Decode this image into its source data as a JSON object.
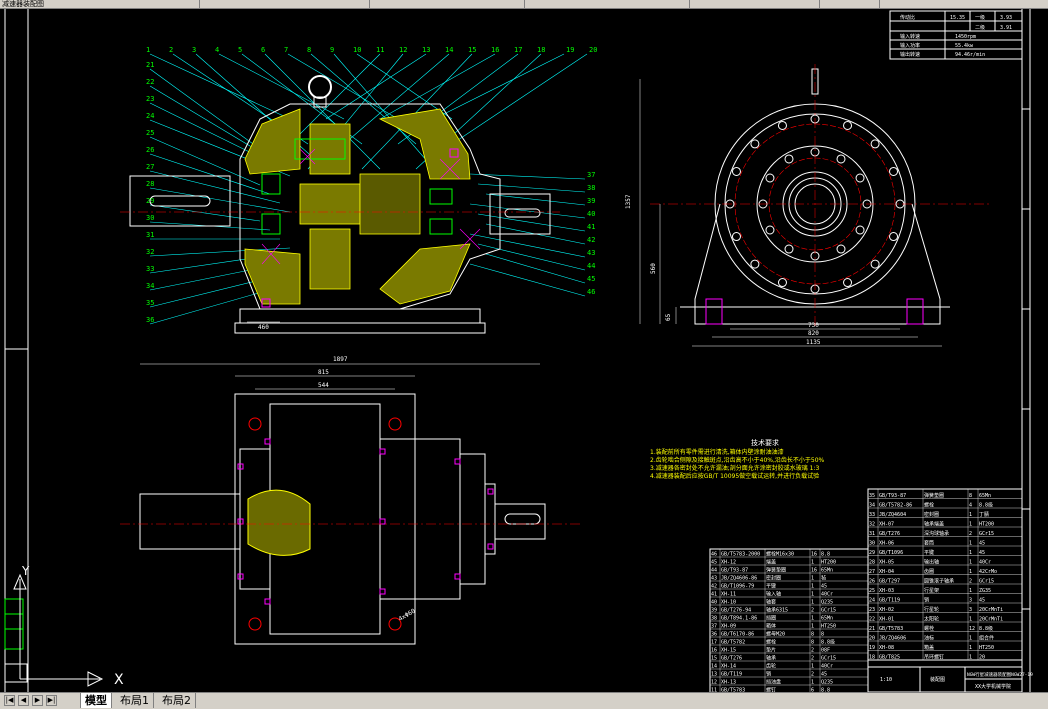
{
  "app": {
    "tabs_top": [
      "减速器装配图",
      "",
      "",
      "",
      "",
      "",
      "",
      ""
    ]
  },
  "layout_tabs": [
    {
      "label": "模型",
      "active": true
    },
    {
      "label": "布局1",
      "active": false
    },
    {
      "label": "布局2",
      "active": false
    }
  ],
  "ucs": {
    "x_label": "X",
    "y_label": "Y"
  },
  "params_table": {
    "rows": [
      {
        "k": "传动比",
        "v1": "15.35",
        "v2": "一级",
        "v3": "3.93"
      },
      {
        "k": "",
        "v1": "",
        "v2": "二级",
        "v3": "3.91"
      },
      {
        "k": "输入转速",
        "v1": "",
        "v2": "",
        "v3": "1450rpm"
      },
      {
        "k": "输入功率",
        "v1": "",
        "v2": "",
        "v3": "55.4kw"
      },
      {
        "k": "输出转速",
        "v1": "",
        "v2": "",
        "v3": "94.46r/min"
      }
    ]
  },
  "dims": {
    "front_height": "1357",
    "center_height": "560",
    "base_w1": "730",
    "base_w2": "820",
    "base_w3": "1135",
    "top_len": "1897",
    "top_w1": "815",
    "top_w2": "544",
    "foot_h": "65",
    "left_dim": "460",
    "hole": "4xΦ60"
  },
  "notes": {
    "title": "技术要求",
    "lines": [
      "1.装配前所有零件需进行清洗,箱体内壁涂耐油油漆",
      "2.齿轮啮合侧隙及接触斑点,沿齿高不小于40%,沿齿长不小于50%",
      "3.减速器各密封处不允许漏油;剖分面允许涂密封胶或水玻璃 1:3",
      "4.减速器装配后应按GB/T 10095做空载试运转,并进行负载试验"
    ]
  },
  "bom_right": {
    "rows": [
      [
        "35",
        "GB/T93-87",
        "弹簧垫圈",
        "8",
        "65Mn"
      ],
      [
        "34",
        "GB/T5782-86",
        "螺栓",
        "4",
        "8.8级"
      ],
      [
        "33",
        "JB/ZQ4604",
        "密封圈",
        "1",
        "丁腈"
      ],
      [
        "32",
        "XH-07",
        "轴承端盖",
        "1",
        "HT200"
      ],
      [
        "31",
        "GB/T276",
        "深沟球轴承",
        "2",
        "GCr15"
      ],
      [
        "30",
        "XH-06",
        "套筒",
        "1",
        "45"
      ],
      [
        "29",
        "GB/T1096",
        "平键",
        "1",
        "45"
      ],
      [
        "28",
        "XH-05",
        "输出轴",
        "1",
        "40Cr"
      ],
      [
        "27",
        "XH-04",
        "齿圈",
        "1",
        "42CrMo"
      ],
      [
        "26",
        "GB/T297",
        "圆锥滚子轴承",
        "2",
        "GCr15"
      ],
      [
        "25",
        "XH-03",
        "行星架",
        "1",
        "ZG35"
      ],
      [
        "24",
        "GB/T119",
        "销",
        "3",
        "45"
      ],
      [
        "23",
        "XH-02",
        "行星轮",
        "3",
        "20CrMnTi"
      ],
      [
        "22",
        "XH-01",
        "太阳轮",
        "1",
        "20CrMnTi"
      ],
      [
        "21",
        "GB/T5783",
        "螺栓",
        "12",
        "8.8级"
      ],
      [
        "20",
        "JB/ZQ4606",
        "油标",
        "1",
        "组合件"
      ],
      [
        "19",
        "XH-08",
        "箱盖",
        "1",
        "HT250"
      ],
      [
        "18",
        "GB/T825",
        "吊环螺钉",
        "1",
        "20"
      ]
    ]
  },
  "bom_left": {
    "rows": [
      [
        "46",
        "GB/T5783-2000",
        "螺栓M16x30",
        "16",
        "8.8"
      ],
      [
        "45",
        "XH-12",
        "端盖",
        "1",
        "HT200"
      ],
      [
        "44",
        "GB/T93-87",
        "弹簧垫圈",
        "16",
        "65Mn"
      ],
      [
        "43",
        "JB/ZQ4606-86",
        "密封圈",
        "1",
        "毡"
      ],
      [
        "42",
        "GB/T1096-79",
        "平键",
        "1",
        "45"
      ],
      [
        "41",
        "XH-11",
        "输入轴",
        "1",
        "40Cr"
      ],
      [
        "40",
        "XH-10",
        "轴套",
        "1",
        "Q235"
      ],
      [
        "39",
        "GB/T276-94",
        "轴承6315",
        "2",
        "GCr15"
      ],
      [
        "38",
        "GB/T894.1-86",
        "挡圈",
        "1",
        "65Mn"
      ],
      [
        "37",
        "XH-09",
        "箱体",
        "1",
        "HT250"
      ],
      [
        "36",
        "GB/T6170-86",
        "螺母M20",
        "8",
        "8"
      ],
      [
        "17",
        "GB/T5782",
        "螺栓",
        "8",
        "8.8级"
      ],
      [
        "16",
        "XH-15",
        "垫片",
        "2",
        "08F"
      ],
      [
        "15",
        "GB/T276",
        "轴承",
        "2",
        "GCr15"
      ],
      [
        "14",
        "XH-14",
        "齿轮",
        "1",
        "40Cr"
      ],
      [
        "13",
        "GB/T119",
        "销",
        "2",
        "45"
      ],
      [
        "12",
        "XH-13",
        "挡油盘",
        "1",
        "Q235"
      ],
      [
        "11",
        "GB/T5783",
        "螺钉",
        "6",
        "8.8"
      ]
    ]
  },
  "title_block": {
    "name": "NGW行星减速器装配图NGW27-19",
    "drawing_label": "装配图",
    "scale": "1:10",
    "school": "XX大学机械学院"
  },
  "left_panel": {
    "items": [
      "",
      "",
      "",
      ""
    ]
  },
  "balloons": [
    "1",
    "2",
    "3",
    "4",
    "5",
    "6",
    "7",
    "8",
    "9",
    "10",
    "11",
    "12",
    "13",
    "14",
    "15",
    "16",
    "17",
    "18",
    "19",
    "20",
    "21",
    "22",
    "23",
    "24",
    "25",
    "26",
    "27",
    "28",
    "29",
    "30",
    "31",
    "32",
    "33",
    "34",
    "35",
    "36",
    "37",
    "38",
    "39",
    "40",
    "41",
    "42",
    "43",
    "44",
    "45",
    "46"
  ]
}
